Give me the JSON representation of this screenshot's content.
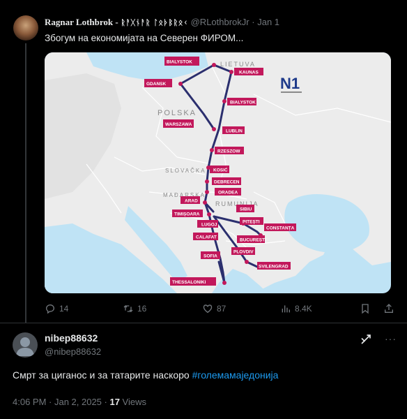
{
  "tweet1": {
    "display_name": "Ragnar Lothbrok -",
    "display_name_runic": "ᚱᚨᚷᚾᚨᚱ ᛚᛟᚦᛒᚱᛟᚲ",
    "handle": "@RLothbrokJr",
    "date": "Jan 1",
    "separator": "·",
    "text": "Збогум на економијата на Северен ФИРОМ...",
    "map": {
      "logo": "N1",
      "countries": [
        "LIETUVA",
        "POLSKA",
        "SLOVAČKA",
        "MAĐARSKA",
        "RUMUNIJA"
      ],
      "cities": [
        "BIALYSTOK",
        "KAUNAS",
        "GDANSK",
        "BIALYSTOK",
        "WARSZAWA",
        "LUBLIN",
        "RZESZOW",
        "KOSIĆ",
        "DEBRECEN",
        "ORADEA",
        "ARAD",
        "TIMIȘOARA",
        "LUGOJ",
        "SIBIU",
        "PITEȘTI",
        "CONSTANȚA",
        "BUCUREȘTI",
        "CALAFAT",
        "SOFIA",
        "PLOVDIV",
        "SVILENGRAD",
        "THESSALONIKI"
      ]
    },
    "actions": {
      "replies": "14",
      "reposts": "16",
      "likes": "87",
      "views": "8.4K"
    },
    "icons": [
      "reply-icon",
      "repost-icon",
      "like-icon",
      "views-icon",
      "bookmark-icon",
      "share-icon"
    ]
  },
  "tweet2": {
    "display_name": "nibep88632",
    "handle": "@nibep88632",
    "text": "Смрт за циганос и за татарите наскоро ",
    "hashtag": "#големамаједонија",
    "time": "4:06 PM · Jan 2, 2025 · ",
    "views_count": "17",
    "views_label": " Views",
    "more": "···"
  },
  "colors": {
    "background": "#000000",
    "text": "#e7e9ea",
    "muted": "#71767b",
    "link": "#1d9bf0",
    "route": "#2b2f6e",
    "label": "#c2185b"
  }
}
